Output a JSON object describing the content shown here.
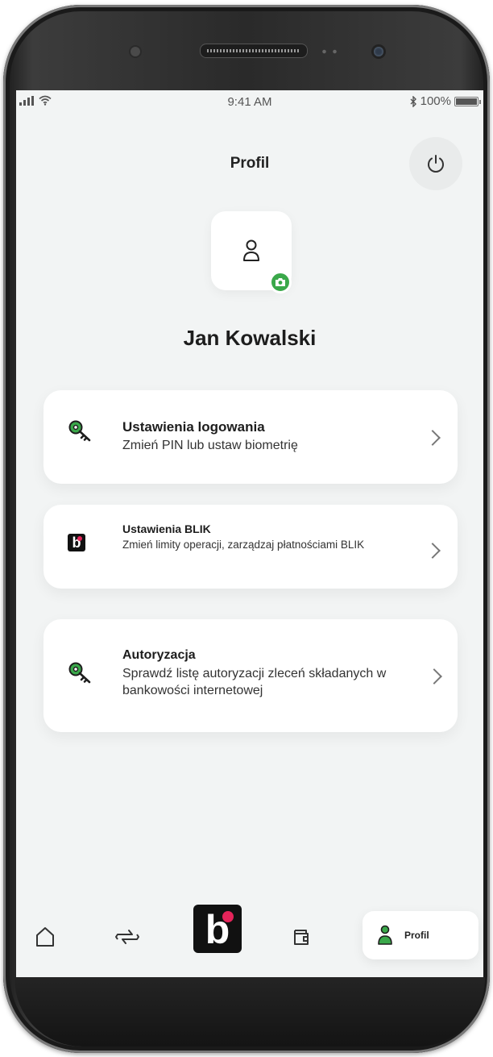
{
  "status_bar": {
    "time": "9:41 AM",
    "battery": "100%",
    "battery_level": 1.0
  },
  "header": {
    "title": "Profil"
  },
  "profile": {
    "name": "Jan Kowalski"
  },
  "menu": {
    "login_settings": {
      "title": "Ustawienia logowania",
      "description": "Zmień PIN lub ustaw biometrię",
      "icon": "key-icon"
    },
    "blik_settings": {
      "title": "Ustawienia BLIK",
      "description": "Zmień limity operacji, zarządzaj płatnościami BLIK",
      "icon": "blik-icon",
      "icon_text": "b"
    },
    "authorization": {
      "title": "Autoryzacja",
      "description": "Sprawdź listę autoryzacji zleceń składanych w bankowości internetowej",
      "icon": "key-icon"
    }
  },
  "bottom_nav": {
    "blik_text": "b",
    "profile_label": "Profil"
  },
  "colors": {
    "accent_green": "#3aa84a",
    "blik_pink": "#e5245a",
    "background": "#f2f4f4"
  }
}
